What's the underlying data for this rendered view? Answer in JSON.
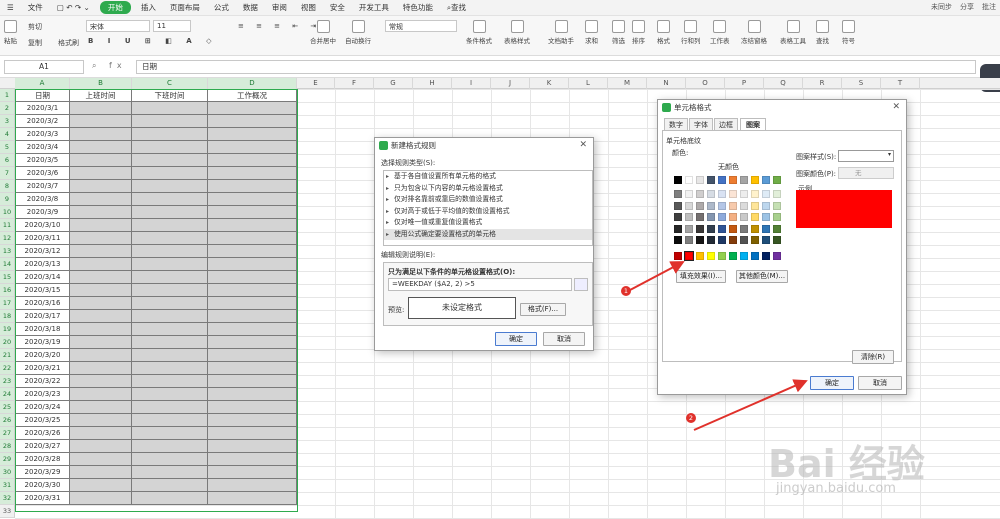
{
  "menubar": {
    "file": "文件",
    "tabs": [
      "开始",
      "插入",
      "页面布局",
      "公式",
      "数据",
      "审阅",
      "视图",
      "安全",
      "开发工具",
      "特色功能"
    ],
    "search": "查找",
    "right": [
      "未同步",
      "分享",
      "批注"
    ]
  },
  "ribbon": {
    "paste": "粘贴",
    "cut": "剪切",
    "copy": "复制",
    "format_painter": "格式刷",
    "font_name": "宋体",
    "font_size": "11",
    "merge": "合并居中",
    "wrap": "自动换行",
    "number_format": "常规",
    "cond_format": "条件格式",
    "table_style": "表格样式",
    "doc_helper": "文档助手",
    "sum": "求和",
    "filter": "筛选",
    "sort": "排序",
    "format": "格式",
    "row_col": "行和列",
    "worksheet": "工作表",
    "freeze": "冻结窗格",
    "table_tools": "表格工具",
    "find": "查找",
    "symbol": "符号"
  },
  "formula_bar": {
    "cell_ref": "A1",
    "content": "日期"
  },
  "columns": [
    "A",
    "B",
    "C",
    "D",
    "E",
    "F",
    "G",
    "H",
    "I",
    "J",
    "K",
    "L",
    "M",
    "N",
    "O",
    "P",
    "Q",
    "R",
    "S",
    "T"
  ],
  "rows": [
    "1",
    "2",
    "3",
    "4",
    "5",
    "6",
    "7",
    "8",
    "9",
    "10",
    "11",
    "12",
    "13",
    "14",
    "15",
    "16",
    "17",
    "18",
    "19",
    "20",
    "21",
    "22",
    "23",
    "24",
    "25",
    "26",
    "27",
    "28",
    "29",
    "30",
    "31",
    "32",
    "33"
  ],
  "table": {
    "headers": [
      "日期",
      "上班时间",
      "下班时间",
      "工作概况"
    ],
    "dates": [
      "2020/3/1",
      "2020/3/2",
      "2020/3/3",
      "2020/3/4",
      "2020/3/5",
      "2020/3/6",
      "2020/3/7",
      "2020/3/8",
      "2020/3/9",
      "2020/3/10",
      "2020/3/11",
      "2020/3/12",
      "2020/3/13",
      "2020/3/14",
      "2020/3/15",
      "2020/3/16",
      "2020/3/17",
      "2020/3/18",
      "2020/3/19",
      "2020/3/20",
      "2020/3/21",
      "2020/3/22",
      "2020/3/23",
      "2020/3/24",
      "2020/3/25",
      "2020/3/26",
      "2020/3/27",
      "2020/3/28",
      "2020/3/29",
      "2020/3/30",
      "2020/3/31"
    ]
  },
  "rule_dialog": {
    "title": "新建格式规则",
    "select_type_label": "选择规则类型(S):",
    "rule_types": [
      "基于各自值设置所有单元格的格式",
      "只为包含以下内容的单元格设置格式",
      "仅对排名靠前或靠后的数值设置格式",
      "仅对高于或低于平均值的数值设置格式",
      "仅对唯一值或重复值设置格式",
      "使用公式确定要设置格式的单元格"
    ],
    "edit_label": "编辑规则说明(E):",
    "formula_label": "只为满足以下条件的单元格设置格式(O):",
    "formula": "=WEEKDAY ($A2, 2) >5",
    "preview_label": "预览:",
    "preview_text": "未设定格式",
    "format_button": "格式(F)...",
    "ok": "确定",
    "cancel": "取消"
  },
  "format_dialog": {
    "title": "单元格格式",
    "tabs": [
      "数字",
      "字体",
      "边框",
      "图案"
    ],
    "shading_label": "单元格底纹",
    "color_label": "颜色:",
    "no_color": "无颜色",
    "pattern_style_label": "图案样式(S):",
    "pattern_color_label": "图案颜色(P):",
    "pattern_color_value": "无",
    "sample_label": "示例",
    "fill_effects": "填充效果(I)...",
    "more_colors": "其他颜色(M)...",
    "clear": "清除(R)",
    "ok": "确定",
    "cancel": "取消",
    "sample_color": "#ff0000"
  },
  "annotations": {
    "badge1": "1",
    "badge2": "2",
    "arrow_color": "#e0312b"
  },
  "watermark": {
    "brand": "Bai 经验",
    "url": "jingyan.baidu.com"
  },
  "colors": {
    "accent": "#2eaa4e",
    "selected_red": "#ff0000"
  },
  "palette_rows": [
    [
      "#000000",
      "#ffffff",
      "#e7e6e6",
      "#44546a",
      "#4472c4",
      "#ed7d31",
      "#a5a5a5",
      "#ffc000",
      "#5b9bd5",
      "#70ad47"
    ],
    [
      "#7f7f7f",
      "#f2f2f2",
      "#d0cece",
      "#d6dce4",
      "#d9e2f3",
      "#fbe4d5",
      "#ededed",
      "#fff2cc",
      "#deebf6",
      "#e2efd9"
    ],
    [
      "#595959",
      "#d8d8d8",
      "#aeaaaa",
      "#adb9ca",
      "#b4c6e7",
      "#f7caac",
      "#dbdbdb",
      "#fee599",
      "#bdd7ee",
      "#c5e0b3"
    ],
    [
      "#3f3f3f",
      "#bfbfbf",
      "#757070",
      "#8496b0",
      "#8eaadb",
      "#f4b083",
      "#c9c9c9",
      "#ffd965",
      "#9cc3e5",
      "#a8d08d"
    ],
    [
      "#262626",
      "#a5a5a5",
      "#3a3838",
      "#323f4f",
      "#2f5496",
      "#c45911",
      "#7b7b7b",
      "#bf9000",
      "#2e75b5",
      "#538135"
    ],
    [
      "#0c0c0c",
      "#7f7f7f",
      "#171616",
      "#222a35",
      "#1f3864",
      "#833c0b",
      "#525252",
      "#7f6000",
      "#1e4e79",
      "#375623"
    ],
    [
      "#c00000",
      "#ff0000",
      "#ffc000",
      "#ffff00",
      "#92d050",
      "#00b050",
      "#00b0f0",
      "#0070c0",
      "#002060",
      "#7030a0"
    ]
  ]
}
